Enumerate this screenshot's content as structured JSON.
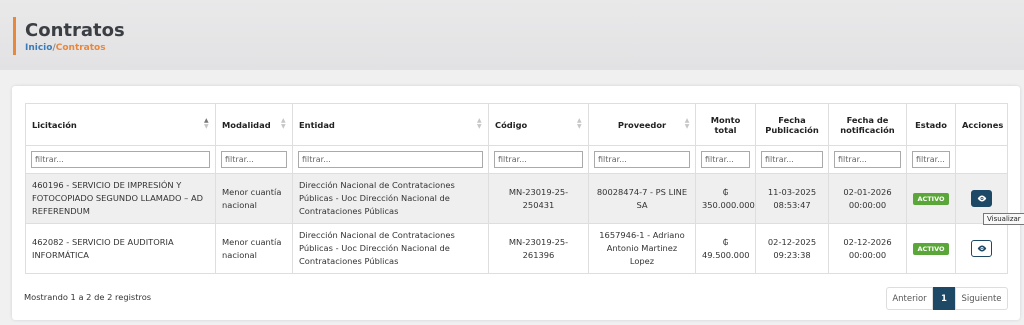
{
  "header": {
    "title": "Contratos",
    "breadcrumb_home": "Inicio",
    "breadcrumb_sep": "/",
    "breadcrumb_current": "Contratos"
  },
  "columns": {
    "licitacion": "Licitación",
    "modalidad": "Modalidad",
    "entidad": "Entidad",
    "codigo": "Código",
    "proveedor": "Proveedor",
    "monto_1": "Monto",
    "monto_2": "total",
    "fecha_pub_1": "Fecha",
    "fecha_pub_2": "Publicación",
    "fecha_not_1": "Fecha de",
    "fecha_not_2": "notificación",
    "estado": "Estado",
    "acciones": "Acciones"
  },
  "filter_placeholder": "filtrar...",
  "rows": [
    {
      "licitacion": "460196 - SERVICIO DE IMPRESIÓN Y FOTOCOPIADO SEGUNDO LLAMADO – AD REFERENDUM",
      "modalidad": "Menor cuantía nacional",
      "entidad": "Dirección Nacional de Contrataciones Públicas - Uoc Dirección Nacional de Contrataciones Públicas",
      "codigo": "MN-23019-25-250431",
      "proveedor": "80028474-7 - PS LINE SA",
      "monto": "₲ 350.000.000",
      "fecha_pub_date": "11-03-2025",
      "fecha_pub_time": "08:53:47",
      "fecha_not_date": "02-01-2026",
      "fecha_not_time": "00:00:00",
      "estado": "ACTIVO"
    },
    {
      "licitacion": "462082 - SERVICIO DE AUDITORIA INFORMÁTICA",
      "modalidad": "Menor cuantía nacional",
      "entidad": "Dirección Nacional de Contrataciones Públicas - Uoc Dirección Nacional de Contrataciones Públicas",
      "codigo": "MN-23019-25-261396",
      "proveedor": "1657946-1 - Adriano Antonio Martinez Lopez",
      "monto": "₲ 49.500.000",
      "fecha_pub_date": "02-12-2025",
      "fecha_pub_time": "09:23:38",
      "fecha_not_date": "02-12-2026",
      "fecha_not_time": "00:00:00",
      "estado": "ACTIVO"
    }
  ],
  "tooltip": "Visualizar",
  "icons": {
    "view": "eye-icon",
    "sort": "sort-arrows-icon"
  },
  "colors": {
    "accent": "#e9873a",
    "primary": "#1d4966",
    "active_badge": "#5aa638",
    "link": "#3b7bb8"
  },
  "footer": {
    "info": "Mostrando 1 a 2 de 2 registros",
    "prev": "Anterior",
    "page": "1",
    "next": "Siguiente"
  }
}
